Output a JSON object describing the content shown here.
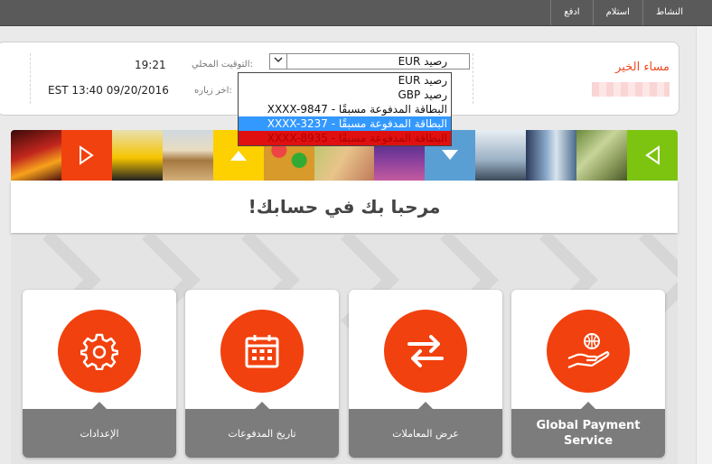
{
  "topnav": {
    "items": [
      "النشاط",
      "استلام",
      "ادفع"
    ]
  },
  "greeting": "مساء الخير",
  "local_time": {
    "label": "التوقيت المحلي:",
    "value": "19:21"
  },
  "last_visit": {
    "label": "اخر زياره:",
    "value": "EST 13:40 09/20/2016"
  },
  "account_select": {
    "value": "رصيد EUR"
  },
  "dropdown": {
    "options": [
      "رصيد EUR",
      "رصيد GBP",
      "البطاقة المدفوعة مسبقًا - XXXX-9847",
      "البطاقة المدفوعة مسبقًا - XXXX-3237",
      "البطاقة المدفوعة مسبقًا - XXXX-8935"
    ]
  },
  "welcome": {
    "title": "مرحبا بك في حسابك!"
  },
  "cards": [
    {
      "label": "Global Payment Service",
      "icon": "hand-globe-icon"
    },
    {
      "label": "عرض المعاملات",
      "icon": "exchange-arrows-icon"
    },
    {
      "label": "تاريخ المدفوعات",
      "icon": "calendar-icon"
    },
    {
      "label": "الإعدادات",
      "icon": "gear-icon"
    }
  ],
  "colors": {
    "accent": "#f1410e",
    "green": "#7dc410",
    "yellow": "#fdd000",
    "blue": "#5a9fd4",
    "label_bg": "#7c7c7c"
  }
}
